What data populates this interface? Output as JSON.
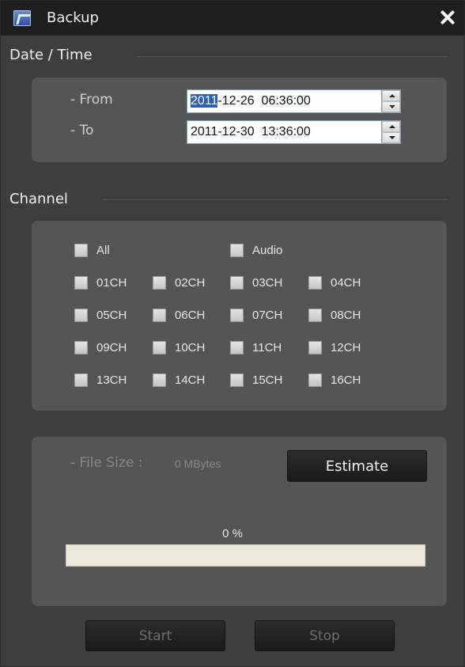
{
  "window": {
    "title": "Backup",
    "logo_icon": "app-logo-icon",
    "close_icon": "close-icon"
  },
  "datetime": {
    "header": "Date / Time",
    "from_label": "- From",
    "from_selected": "2011",
    "from_rest": "-12-26  06:36:00",
    "to_label": "- To",
    "to_value": "2011-12-30  13:36:00"
  },
  "channel": {
    "header": "Channel",
    "all_label": "All",
    "audio_label": "Audio",
    "channels": [
      "01CH",
      "02CH",
      "03CH",
      "04CH",
      "05CH",
      "06CH",
      "07CH",
      "08CH",
      "09CH",
      "10CH",
      "11CH",
      "12CH",
      "13CH",
      "14CH",
      "15CH",
      "16CH"
    ]
  },
  "backup": {
    "file_size_label": "- File Size :",
    "file_size_value": "0 MBytes",
    "estimate_label": "Estimate",
    "progress_text": "0 %",
    "progress_fraction": 0,
    "start_label": "Start",
    "stop_label": "Stop"
  },
  "colors": {
    "selection": "#2c5fb8",
    "panel": "#555555",
    "background": "#3e3e3e",
    "titlebar": "#1e1e1e",
    "progress_track": "#ece8db"
  }
}
